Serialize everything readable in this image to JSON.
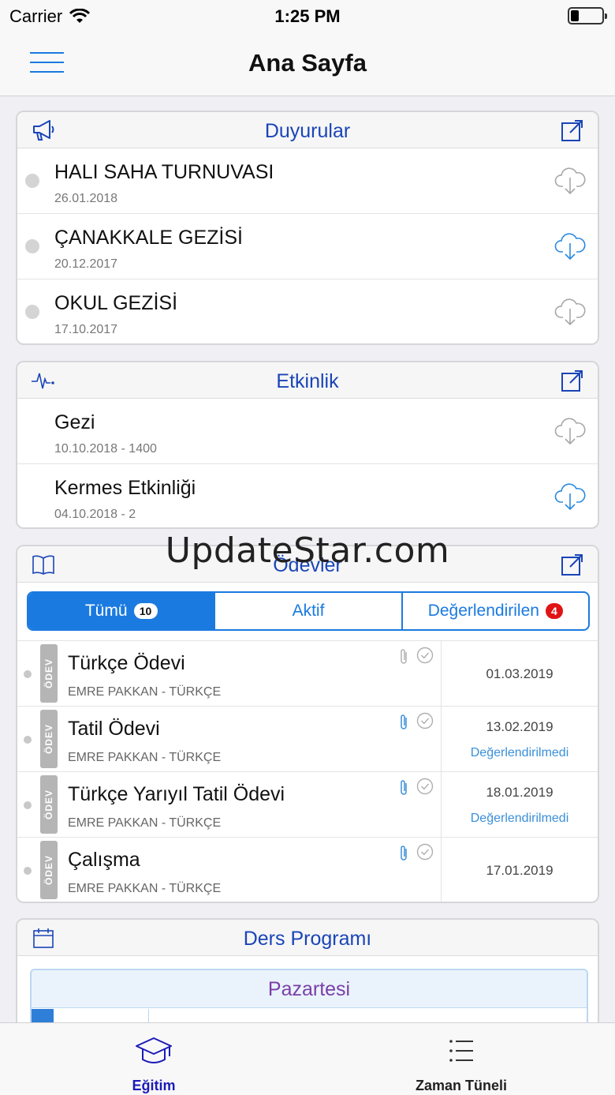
{
  "status": {
    "carrier": "Carrier",
    "time": "1:25 PM"
  },
  "nav": {
    "title": "Ana Sayfa"
  },
  "announcements": {
    "title": "Duyurular",
    "items": [
      {
        "title": "HALI SAHA TURNUVASI",
        "date": "26.01.2018",
        "download_color": "#a8a8a8"
      },
      {
        "title": "ÇANAKKALE GEZİSİ",
        "date": "20.12.2017",
        "download_color": "#2a8ae0"
      },
      {
        "title": "OKUL GEZİSİ",
        "date": "17.10.2017",
        "download_color": "#a8a8a8"
      }
    ]
  },
  "events": {
    "title": "Etkinlik",
    "items": [
      {
        "title": "Gezi",
        "date": "10.10.2018 - 1400",
        "download_color": "#a8a8a8"
      },
      {
        "title": "Kermes Etkinliği",
        "date": "04.10.2018 - 2",
        "download_color": "#2a8ae0"
      }
    ]
  },
  "homework": {
    "title": "Ödevler",
    "tabs": [
      {
        "label": "Tümü",
        "badge": "10"
      },
      {
        "label": "Aktif",
        "badge": ""
      },
      {
        "label": "Değerlendirilen",
        "badge": "4"
      }
    ],
    "tag": "ÖDEV",
    "items": [
      {
        "title": "Türkçe Ödevi",
        "author": "EMRE PAKKAN - TÜRKÇE",
        "date": "01.03.2019",
        "status": ""
      },
      {
        "title": "Tatil Ödevi",
        "author": "EMRE PAKKAN - TÜRKÇE",
        "date": "13.02.2019",
        "status": "Değerlendirilmedi"
      },
      {
        "title": "Türkçe Yarıyıl Tatil Ödevi",
        "author": "EMRE PAKKAN - TÜRKÇE",
        "date": "18.01.2019",
        "status": "Değerlendirilmedi"
      },
      {
        "title": "Çalışma",
        "author": "EMRE PAKKAN - TÜRKÇE",
        "date": "17.01.2019",
        "status": ""
      }
    ]
  },
  "schedule": {
    "title": "Ders Programı",
    "day": "Pazartesi"
  },
  "watermark": "UpdateStar.com",
  "tabbar": [
    {
      "label": "Eğitim",
      "active": true
    },
    {
      "label": "Zaman Tüneli",
      "active": false
    }
  ],
  "colors": {
    "accent": "#1a7ae0",
    "header_text": "#1a45b8",
    "active_tab": "#1b1bb8",
    "badge_red": "#e01414"
  }
}
